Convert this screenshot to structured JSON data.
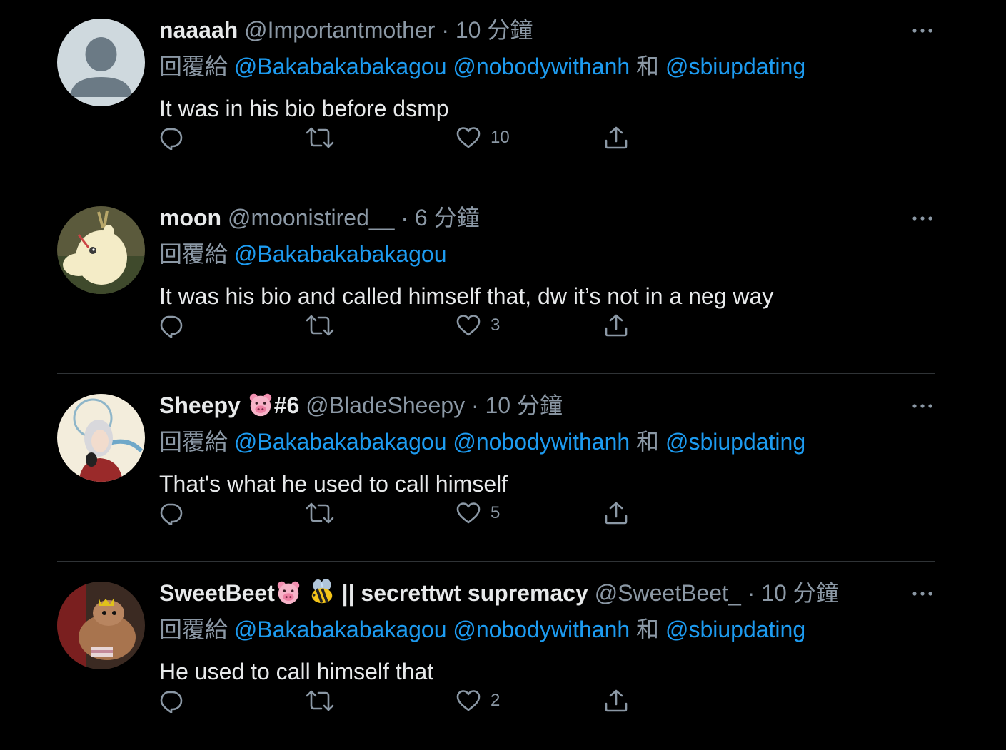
{
  "reply_prefix": "回覆給",
  "and_word": "和",
  "separator": "·",
  "colors": {
    "background": "#000000",
    "text": "#e7e9ea",
    "muted": "#8b98a5",
    "link": "#1d9bf0",
    "divider": "#2f3336"
  },
  "tweets": [
    {
      "name": "naaaah",
      "handle": "@Importantmother",
      "time": "10 分鐘",
      "mentions": [
        "@Bakabakabakagou",
        "@nobodywithanh",
        "@sbiupdating"
      ],
      "text": "It was in his bio before dsmp",
      "likes": "10",
      "avatar": "default-avatar"
    },
    {
      "name": "moon",
      "handle": "@moonistired__",
      "time": "6 分鐘",
      "mentions": [
        "@Bakabakabakagou"
      ],
      "text": "It was his bio and called himself that, dw it’s not in a neg way",
      "likes": "3",
      "avatar": "moomin-avatar"
    },
    {
      "name": "Sheepy",
      "name_suffix": "#6",
      "handle": "@BladeSheepy",
      "time": "10 分鐘",
      "mentions": [
        "@Bakabakabakagou",
        "@nobodywithanh",
        "@sbiupdating"
      ],
      "text": "That's what he used to call himself",
      "likes": "5",
      "avatar": "anime-avatar"
    },
    {
      "name": "SweetBeet",
      "name_suffix": "|| secrettwt supremacy",
      "handle": "@SweetBeet_",
      "time": "10 分鐘",
      "mentions": [
        "@Bakabakabakagou",
        "@nobodywithanh",
        "@sbiupdating"
      ],
      "text": "He used to call himself that",
      "likes": "2",
      "avatar": "plush-avatar"
    }
  ]
}
